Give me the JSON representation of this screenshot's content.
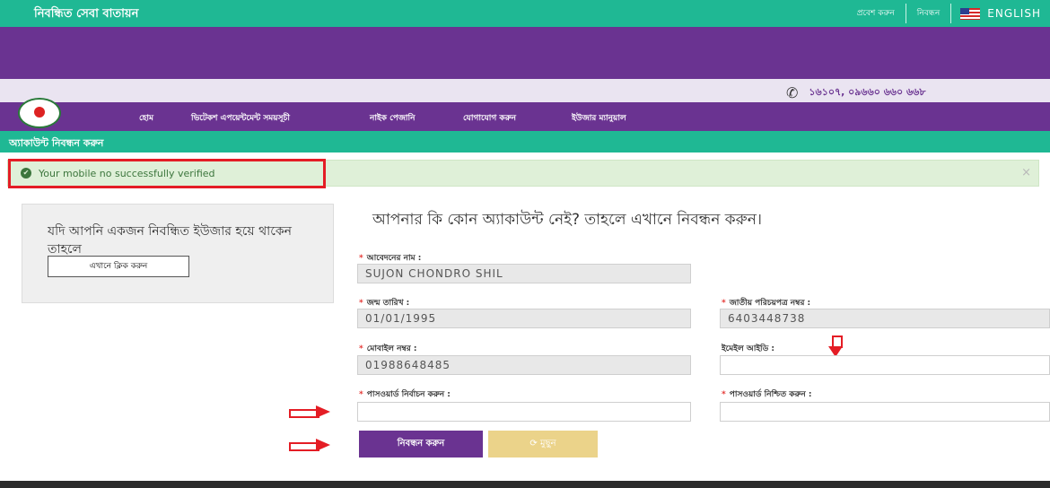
{
  "topbar": {
    "site_name": "নিবন্ধিত সেবা বাতায়ন",
    "link_help": "প্রবেশ করুন",
    "link_register": "নিবন্ধন",
    "language": "ENGLISH"
  },
  "phonebar": {
    "numbers": "১৬১০৭, ০৯৬৬০ ৬৬০ ৬৬৮"
  },
  "nav": {
    "items": [
      "হোম",
      "ভিটেকশ এপয়েন্টমেন্ট সময়সূচী",
      "নাইক পেজানি",
      "যোগাযোগ করুন",
      "ইউজার ম্যানুয়াল"
    ]
  },
  "page_title": "অ্যাকাউন্ট নিবন্ধন করুন",
  "alert": {
    "message": "Your mobile no successfully verified",
    "close": "×"
  },
  "sidebar": {
    "text": "যদি আপনি একজন নিবন্ধিত ইউজার হয়ে থাকেন তাহলে",
    "button": "এখানে ক্লিক করুন"
  },
  "form": {
    "heading": "আপনার কি কোন অ্যাকাউন্ট নেই? তাহলে এখানে নিবন্ধন করুন।",
    "name_label": "আবেদনের নাম :",
    "name_value": "SUJON CHONDRO SHIL",
    "dob_label": "জন্ম তারিখ :",
    "dob_value": "01/01/1995",
    "nid_label": "জাতীয় পরিচয়পত্র নম্বর :",
    "nid_value": "6403448738",
    "mobile_label": "মোবাইল নম্বর :",
    "mobile_value": "01988648485",
    "email_label": "ইমেইল আইডি :",
    "email_value": "",
    "password_label": "পাসওয়ার্ড নির্বাচন করুন :",
    "password_value": "",
    "confirm_label": "পাসওয়ার্ড নিশ্চিত করুন :",
    "confirm_value": "",
    "submit": "নিবন্ধন করুন",
    "reset": "মুছুন"
  },
  "colors": {
    "green": "#1fb894",
    "purple": "#6a3391",
    "alert_bg": "#dff0d8",
    "annotation_red": "#e41d25",
    "reset_yellow": "#ebd38a"
  }
}
